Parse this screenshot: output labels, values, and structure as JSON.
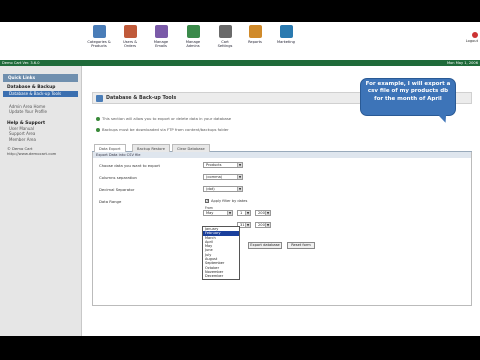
{
  "toolbar": {
    "items": [
      {
        "label": "Categories &\nProducts",
        "icon": "categories-icon",
        "color": "#4a7db8"
      },
      {
        "label": "Users &\nOrders",
        "icon": "users-icon",
        "color": "#c05a3a"
      },
      {
        "label": "Manage\nEmails",
        "icon": "emails-icon",
        "color": "#7a5aa8"
      },
      {
        "label": "Manage\nAdmins",
        "icon": "admins-icon",
        "color": "#3a8a4a"
      },
      {
        "label": "Cart\nSettings",
        "icon": "settings-icon",
        "color": "#6a6a6a"
      },
      {
        "label": "Reports",
        "icon": "reports-icon",
        "color": "#d08a2a"
      },
      {
        "label": "Marketing",
        "icon": "marketing-icon",
        "color": "#2a7ab0"
      }
    ],
    "logout": "Logout"
  },
  "strip": {
    "left": "Demo Cart Ver. 3.6.0",
    "right": "Mon May 1, 2006"
  },
  "sidebar": {
    "header": "Quick Links",
    "section1": "Database & Backup",
    "active_item": "Database & Back-up Tools",
    "items": [
      "Admin Area Home",
      "Update Your Profile"
    ],
    "section2": "Help & Support",
    "help_items": [
      "User Manual",
      "Support Area",
      "Member Area"
    ],
    "footer_name": "© Demo Cart",
    "footer_url": "http://www.democart.com"
  },
  "main": {
    "title": "Database & Back-up Tools",
    "info1": "This section will allow you to export or delete data in your database",
    "info2": "Backups must be downloaded via FTP from content/backups folder",
    "tabs": [
      "Data Export",
      "Backup Restore",
      "Clear Database"
    ],
    "form_header": "Export Data into CSV file",
    "fields": {
      "what_label": "Choose data you want to export",
      "what_value": "Products",
      "sep_label": "Columns separation",
      "sep_value": "(comma)",
      "dec_label": "Decimal Separator",
      "dec_value": "(dot)",
      "range_label": "Data Range",
      "filter_label": "Apply filter by dates",
      "from_label": "From",
      "from_month": "May",
      "from_day": "1",
      "from_year": "2006",
      "to_day": "31",
      "to_year": "2006"
    },
    "months": [
      "January",
      "February",
      "March",
      "April",
      "May",
      "June",
      "July",
      "August",
      "September",
      "October",
      "November",
      "December"
    ],
    "highlighted_month": "February",
    "buttons": {
      "export": "Export database",
      "reset": "Reset form"
    }
  },
  "callout": "For example, I will export a csv file of my products db for the month of April"
}
